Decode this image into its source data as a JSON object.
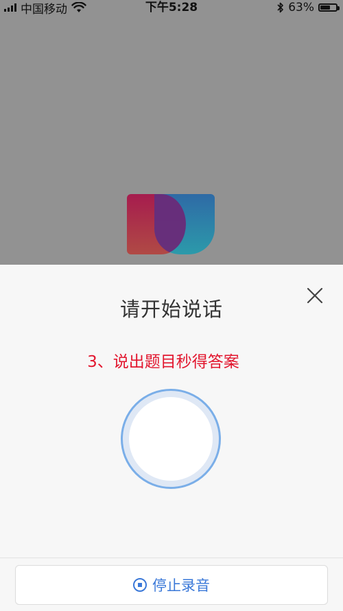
{
  "status_bar": {
    "carrier": "中国移动",
    "time": "下午5:28",
    "battery_percent": "63%",
    "battery_level": 0.63,
    "icons": [
      "signal-icon",
      "wifi-icon",
      "bluetooth-icon",
      "battery-icon"
    ]
  },
  "sheet": {
    "title": "请开始说话",
    "caption": "3、说出题目秒得答案",
    "stop_label": "停止录音",
    "accent_color": "#3a78d8",
    "caption_color": "#e2162e"
  }
}
